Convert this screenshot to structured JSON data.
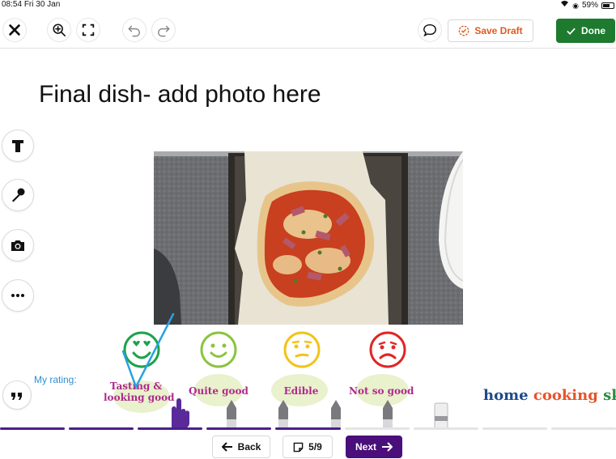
{
  "status_bar": {
    "time": "08:54",
    "date": "Fri 30 Jan",
    "battery": "59%"
  },
  "toolbar": {
    "save_draft_label": "Save Draft",
    "done_label": "Done"
  },
  "content": {
    "heading": "Final dish- add photo here"
  },
  "sidebar": {
    "tools": [
      "text-tool",
      "microphone-tool",
      "camera-tool",
      "more-tool",
      "quote-tool"
    ]
  },
  "rating": {
    "label": "My rating:",
    "options": [
      {
        "label_line1": "Tasting &",
        "label_line2": "looking good",
        "color": "#1da34a"
      },
      {
        "label_line1": "Quite good",
        "label_line2": "",
        "color": "#8ac43f"
      },
      {
        "label_line1": "Edible",
        "label_line2": "",
        "color": "#f2c318"
      },
      {
        "label_line1": "Not so good",
        "label_line2": "",
        "color": "#e02626"
      }
    ]
  },
  "brand": {
    "part1": "home ",
    "part2": "cooking ",
    "part3": "skills"
  },
  "progress": {
    "current": 5,
    "total": 9,
    "accent": "#4a1f8a"
  },
  "navigation": {
    "back_label": "Back",
    "page_indicator": "5/9",
    "next_label": "Next"
  },
  "colors": {
    "done_green": "#1d7a2e",
    "save_orange": "#e05a1e",
    "next_purple": "#4a0f7a",
    "annotation_blue": "#2aa2e0"
  }
}
